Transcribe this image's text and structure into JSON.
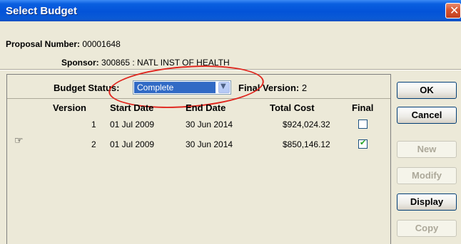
{
  "window": {
    "title": "Select Budget"
  },
  "info": {
    "proposal_label": "Proposal Number:",
    "proposal_value": "00001648",
    "sponsor_label": "Sponsor:",
    "sponsor_value": "300865 : NATL INST OF HEALTH"
  },
  "budget_status": {
    "label": "Budget Status:",
    "selected": "Complete",
    "final_version_label": "Final Version:",
    "final_version_value": "2"
  },
  "table": {
    "columns": [
      "Version",
      "Start Date",
      "End Date",
      "Total Cost",
      "Final"
    ],
    "rows": [
      {
        "version": "1",
        "start": "01 Jul 2009",
        "end": "30 Jun 2014",
        "total": "$924,024.32",
        "final": false,
        "pointer": false
      },
      {
        "version": "2",
        "start": "01 Jul 2009",
        "end": "30 Jun 2014",
        "total": "$850,146.12",
        "final": true,
        "pointer": true
      }
    ]
  },
  "buttons": {
    "ok": "OK",
    "cancel": "Cancel",
    "new": "New",
    "modify": "Modify",
    "display": "Display",
    "copy": "Copy"
  },
  "colors": {
    "highlight_ellipse": "#e0261e",
    "selection": "#316ac5",
    "titlebar": "#0353d8"
  }
}
